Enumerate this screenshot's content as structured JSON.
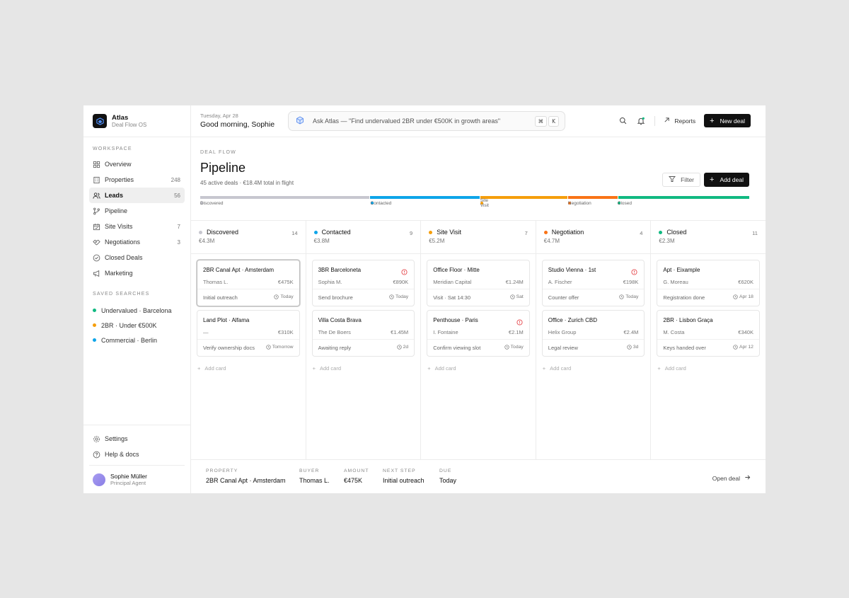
{
  "brand": {
    "name": "Atlas",
    "subtitle": "Deal Flow OS"
  },
  "sidebar": {
    "workspace_label": "WORKSPACE",
    "items": [
      {
        "label": "Overview",
        "count": "",
        "icon": "grid-icon"
      },
      {
        "label": "Properties",
        "count": "248",
        "icon": "building-icon"
      },
      {
        "label": "Leads",
        "count": "56",
        "icon": "users-icon",
        "active": true
      },
      {
        "label": "Pipeline",
        "count": "",
        "icon": "branch-icon"
      },
      {
        "label": "Site Visits",
        "count": "7",
        "icon": "calendar-check-icon"
      },
      {
        "label": "Negotiations",
        "count": "3",
        "icon": "handshake-icon"
      },
      {
        "label": "Closed Deals",
        "count": "",
        "icon": "check-circle-icon"
      },
      {
        "label": "Marketing",
        "count": "",
        "icon": "megaphone-icon"
      }
    ],
    "saved_label": "SAVED SEARCHES",
    "saved": [
      {
        "label": "Undervalued · Barcelona",
        "color": "#10b981"
      },
      {
        "label": "2BR · Under €500K",
        "color": "#f59e0b"
      },
      {
        "label": "Commercial · Berlin",
        "color": "#0ea5e9"
      }
    ],
    "settings_label": "Settings",
    "help_label": "Help & docs",
    "user": {
      "name": "Sophie Müller",
      "role": "Principal Agent"
    }
  },
  "topbar": {
    "date": "Tuesday, Apr 28",
    "greeting": "Good morning, Sophie",
    "ask": "Ask Atlas — \"Find undervalued 2BR under €500K in growth areas\"",
    "kbd_cmd": "⌘",
    "kbd_key": "K",
    "reports_label": "Reports",
    "new_deal_label": "New deal"
  },
  "header": {
    "eyebrow": "DEAL FLOW",
    "title": "Pipeline",
    "subtitle": "45 active deals · €18.4M total in flight",
    "filter_label": "Filter",
    "add_deal_label": "Add deal"
  },
  "stage_bar": [
    {
      "label": "Discovered",
      "share": 0.31,
      "color": "#c7c7cf"
    },
    {
      "label": "Contacted",
      "share": 0.2,
      "color": "#0ea5e9"
    },
    {
      "label": "Site Visit",
      "share": 0.16,
      "color": "#f59e0b"
    },
    {
      "label": "Negotiation",
      "share": 0.09,
      "color": "#f97316"
    },
    {
      "label": "Closed",
      "share": 0.24,
      "color": "#10b981"
    }
  ],
  "columns": [
    {
      "title": "Discovered",
      "count": "14",
      "value": "€4.3M",
      "color": "#c7c7cf",
      "cards": [
        {
          "title": "2BR Canal Apt · Amsterdam",
          "who": "Thomas L.",
          "amount": "€475K",
          "step": "Initial outreach",
          "due": "Today",
          "alert": false,
          "selected": true
        },
        {
          "title": "Land Plot · Alfama",
          "who": "—",
          "amount": "€310K",
          "step": "Verify ownership docs",
          "due": "Tomorrow",
          "alert": false
        }
      ]
    },
    {
      "title": "Contacted",
      "count": "9",
      "value": "€3.8M",
      "color": "#0ea5e9",
      "cards": [
        {
          "title": "3BR Barceloneta",
          "who": "Sophia M.",
          "amount": "€890K",
          "step": "Send brochure",
          "due": "Today",
          "alert": true
        },
        {
          "title": "Villa Costa Brava",
          "who": "The De Boers",
          "amount": "€1.45M",
          "step": "Awaiting reply",
          "due": "2d",
          "alert": false
        }
      ]
    },
    {
      "title": "Site Visit",
      "count": "7",
      "value": "€5.2M",
      "color": "#f59e0b",
      "cards": [
        {
          "title": "Office Floor · Mitte",
          "who": "Meridian Capital",
          "amount": "€1.24M",
          "step": "Visit · Sat 14:30",
          "due": "Sat",
          "alert": false
        },
        {
          "title": "Penthouse · Paris",
          "who": "I. Fontaine",
          "amount": "€2.1M",
          "step": "Confirm viewing slot",
          "due": "Today",
          "alert": true
        }
      ]
    },
    {
      "title": "Negotiation",
      "count": "4",
      "value": "€4.7M",
      "color": "#f97316",
      "cards": [
        {
          "title": "Studio Vienna · 1st",
          "who": "A. Fischer",
          "amount": "€198K",
          "step": "Counter offer",
          "due": "Today",
          "alert": true
        },
        {
          "title": "Office · Zurich CBD",
          "who": "Helix Group",
          "amount": "€2.4M",
          "step": "Legal review",
          "due": "3d",
          "alert": false
        }
      ]
    },
    {
      "title": "Closed",
      "count": "11",
      "value": "€2.3M",
      "color": "#10b981",
      "cards": [
        {
          "title": "Apt · Eixample",
          "who": "G. Moreau",
          "amount": "€620K",
          "step": "Registration done",
          "due": "Apr 18",
          "alert": false
        },
        {
          "title": "2BR · Lisbon Graça",
          "who": "M. Costa",
          "amount": "€340K",
          "step": "Keys handed over",
          "due": "Apr 12",
          "alert": false
        }
      ]
    }
  ],
  "add_card_label": "Add card",
  "detail": {
    "fields": [
      {
        "key": "PROPERTY",
        "value": "2BR Canal Apt · Amsterdam"
      },
      {
        "key": "BUYER",
        "value": "Thomas L."
      },
      {
        "key": "AMOUNT",
        "value": "€475K"
      },
      {
        "key": "NEXT STEP",
        "value": "Initial outreach"
      },
      {
        "key": "DUE",
        "value": "Today"
      }
    ],
    "open_label": "Open deal"
  },
  "colors": {
    "accent": "#111111",
    "alert": "#e5484d",
    "brand_logo": "#3b82f6"
  }
}
